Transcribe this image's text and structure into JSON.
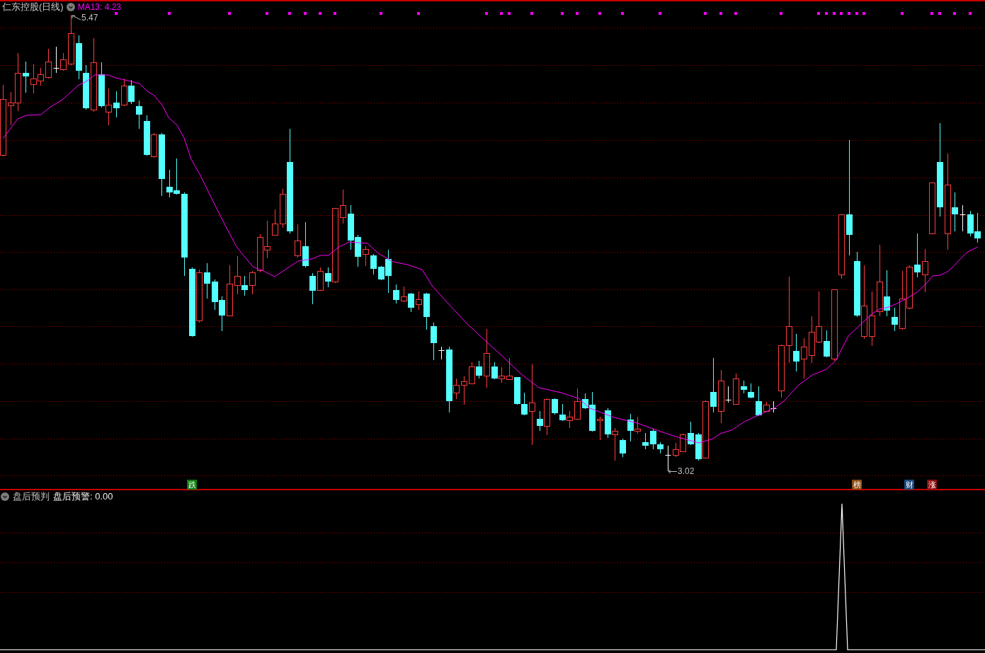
{
  "chart_header": {
    "title": "仁东控股(日线)",
    "ma_reading": "MA13: 4.23"
  },
  "price_labels": [
    {
      "kind": "high",
      "value": "5.47"
    },
    {
      "kind": "low",
      "value": "3.02"
    }
  ],
  "event_markers": [
    {
      "label": "跌",
      "color": "#0f7d0f"
    },
    {
      "label": "榜",
      "color": "#8a4c12"
    },
    {
      "label": "财",
      "color": "#1a4a80"
    },
    {
      "label": "涨",
      "color": "#8c0e0e"
    }
  ],
  "indicator_header": {
    "name": "盘后预判",
    "reading": "盘后预警: 0.00"
  }
}
